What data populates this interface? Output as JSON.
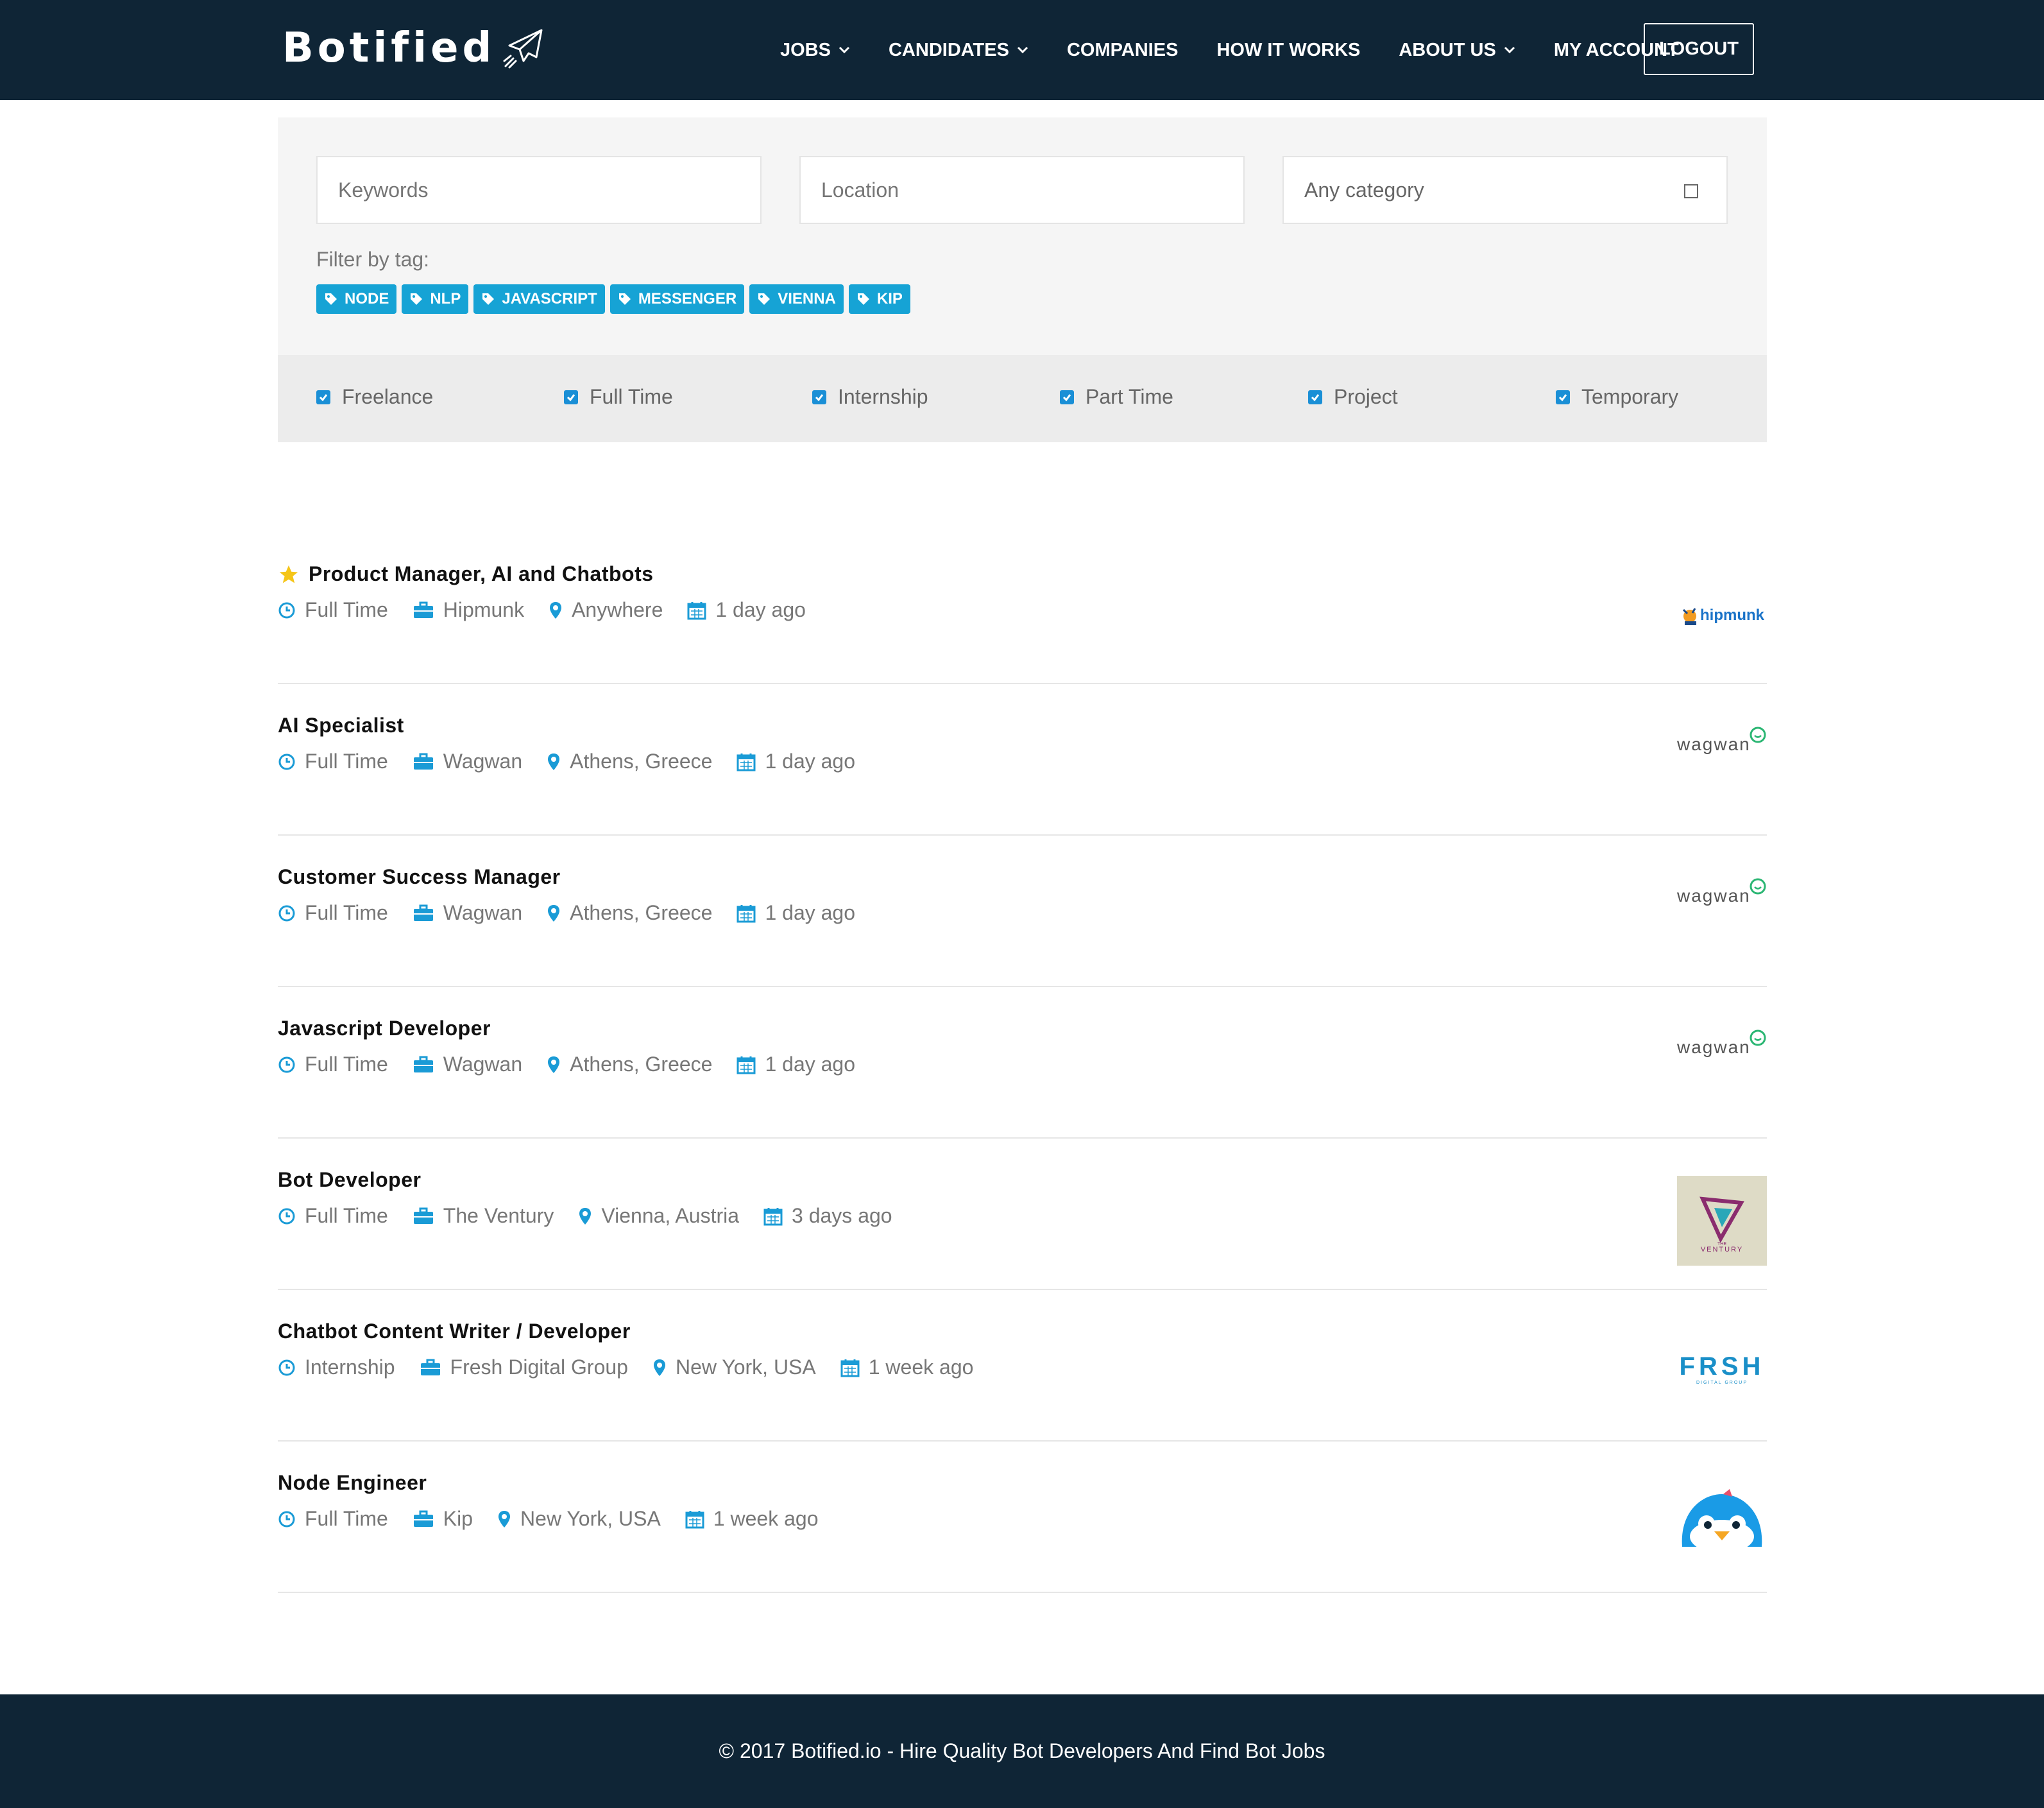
{
  "header": {
    "brand": "Botified",
    "nav": [
      {
        "label": "JOBS",
        "dropdown": true
      },
      {
        "label": "CANDIDATES",
        "dropdown": true
      },
      {
        "label": "COMPANIES",
        "dropdown": false
      },
      {
        "label": "HOW IT WORKS",
        "dropdown": false
      },
      {
        "label": "ABOUT US",
        "dropdown": true
      },
      {
        "label": "MY ACCOUNT",
        "dropdown": false
      }
    ],
    "logout_label": "LOGOUT"
  },
  "search": {
    "keywords_placeholder": "Keywords",
    "location_placeholder": "Location",
    "category_value": "Any category",
    "filter_label": "Filter by tag:",
    "tags": [
      "NODE",
      "NLP",
      "JAVASCRIPT",
      "MESSENGER",
      "VIENNA",
      "KIP"
    ],
    "job_types": [
      {
        "label": "Freelance",
        "checked": true
      },
      {
        "label": "Full Time",
        "checked": true
      },
      {
        "label": "Internship",
        "checked": true
      },
      {
        "label": "Part Time",
        "checked": true
      },
      {
        "label": "Project",
        "checked": true
      },
      {
        "label": "Temporary",
        "checked": true
      }
    ]
  },
  "jobs": [
    {
      "title": "Product Manager, AI and Chatbots",
      "featured": true,
      "type": "Full Time",
      "company": "Hipmunk",
      "location": "Anywhere",
      "posted": "1 day ago",
      "logo": "hipmunk"
    },
    {
      "title": "AI Specialist",
      "featured": false,
      "type": "Full Time",
      "company": "Wagwan",
      "location": "Athens, Greece",
      "posted": "1 day ago",
      "logo": "wagwan"
    },
    {
      "title": "Customer Success Manager",
      "featured": false,
      "type": "Full Time",
      "company": "Wagwan",
      "location": "Athens, Greece",
      "posted": "1 day ago",
      "logo": "wagwan"
    },
    {
      "title": "Javascript Developer",
      "featured": false,
      "type": "Full Time",
      "company": "Wagwan",
      "location": "Athens, Greece",
      "posted": "1 day ago",
      "logo": "wagwan"
    },
    {
      "title": "Bot Developer",
      "featured": false,
      "type": "Full Time",
      "company": "The Ventury",
      "location": "Vienna, Austria",
      "posted": "3 days ago",
      "logo": "ventury"
    },
    {
      "title": "Chatbot Content Writer / Developer",
      "featured": false,
      "type": "Internship",
      "company": "Fresh Digital Group",
      "location": "New York, USA",
      "posted": "1 week ago",
      "logo": "frsh"
    },
    {
      "title": "Node Engineer",
      "featured": false,
      "type": "Full Time",
      "company": "Kip",
      "location": "New York, USA",
      "posted": "1 week ago",
      "logo": "kip"
    }
  ],
  "logos": {
    "hipmunk_text": "hipmunk",
    "wagwan_text": "wagwan",
    "ventury_text": "VENTURY",
    "ventury_small": "THE",
    "frsh_text": "FRSH",
    "frsh_sub": "DIGITAL GROUP"
  },
  "footer": {
    "text": "© 2017 Botified.io - Hire Quality Bot Developers And Find Bot Jobs"
  },
  "colors": {
    "header_bg": "#0f2536",
    "accent": "#16a3d5",
    "checkbox": "#1a8fd6",
    "star": "#f5c518"
  }
}
